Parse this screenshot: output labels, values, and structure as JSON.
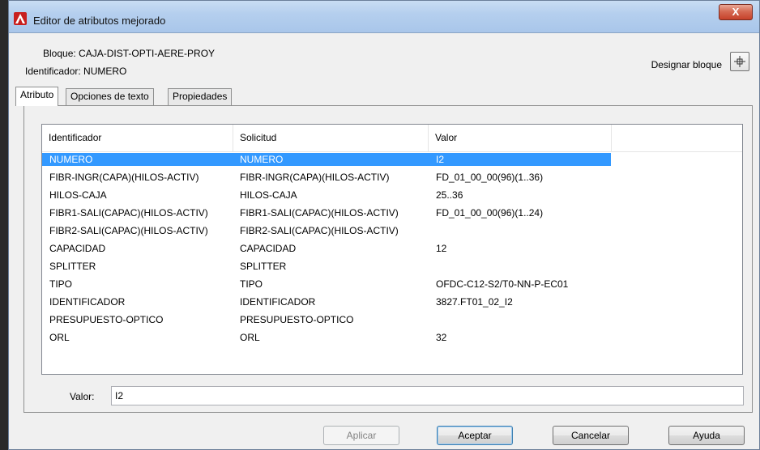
{
  "window": {
    "title": "Editor de atributos mejorado",
    "close_label": "X"
  },
  "info": {
    "block": "Bloque: CAJA-DIST-OPTI-AERE-PROY",
    "identifier": "Identificador: NUMERO",
    "designate_label": "Designar bloque"
  },
  "tabs": [
    {
      "label": "Atributo"
    },
    {
      "label": "Opciones de texto"
    },
    {
      "label": "Propiedades"
    }
  ],
  "table": {
    "columns": [
      "Identificador",
      "Solicitud",
      "Valor"
    ],
    "rows": [
      {
        "id": "NUMERO",
        "prompt": "NUMERO",
        "value": "I2"
      },
      {
        "id": "FIBR-INGR(CAPA)(HILOS-ACTIV)",
        "prompt": "FIBR-INGR(CAPA)(HILOS-ACTIV)",
        "value": "FD_01_00_00(96)(1..36)"
      },
      {
        "id": "HILOS-CAJA",
        "prompt": "HILOS-CAJA",
        "value": "25..36"
      },
      {
        "id": "FIBR1-SALI(CAPAC)(HILOS-ACTIV)",
        "prompt": "FIBR1-SALI(CAPAC)(HILOS-ACTIV)",
        "value": "FD_01_00_00(96)(1..24)"
      },
      {
        "id": "FIBR2-SALI(CAPAC)(HILOS-ACTIV)",
        "prompt": "FIBR2-SALI(CAPAC)(HILOS-ACTIV)",
        "value": ""
      },
      {
        "id": "CAPACIDAD",
        "prompt": "CAPACIDAD",
        "value": "12"
      },
      {
        "id": "SPLITTER",
        "prompt": "SPLITTER",
        "value": ""
      },
      {
        "id": "TIPO",
        "prompt": "TIPO",
        "value": "OFDC-C12-S2/T0-NN-P-EC01"
      },
      {
        "id": "IDENTIFICADOR",
        "prompt": "IDENTIFICADOR",
        "value": "3827.FT01_02_I2"
      },
      {
        "id": "PRESUPUESTO-OPTICO",
        "prompt": "PRESUPUESTO-OPTICO",
        "value": ""
      },
      {
        "id": "ORL",
        "prompt": "ORL",
        "value": "32"
      }
    ]
  },
  "valor": {
    "label": "Valor:",
    "value": "I2"
  },
  "buttons": {
    "apply": "Aplicar",
    "ok": "Aceptar",
    "cancel": "Cancelar",
    "help": "Ayuda"
  }
}
